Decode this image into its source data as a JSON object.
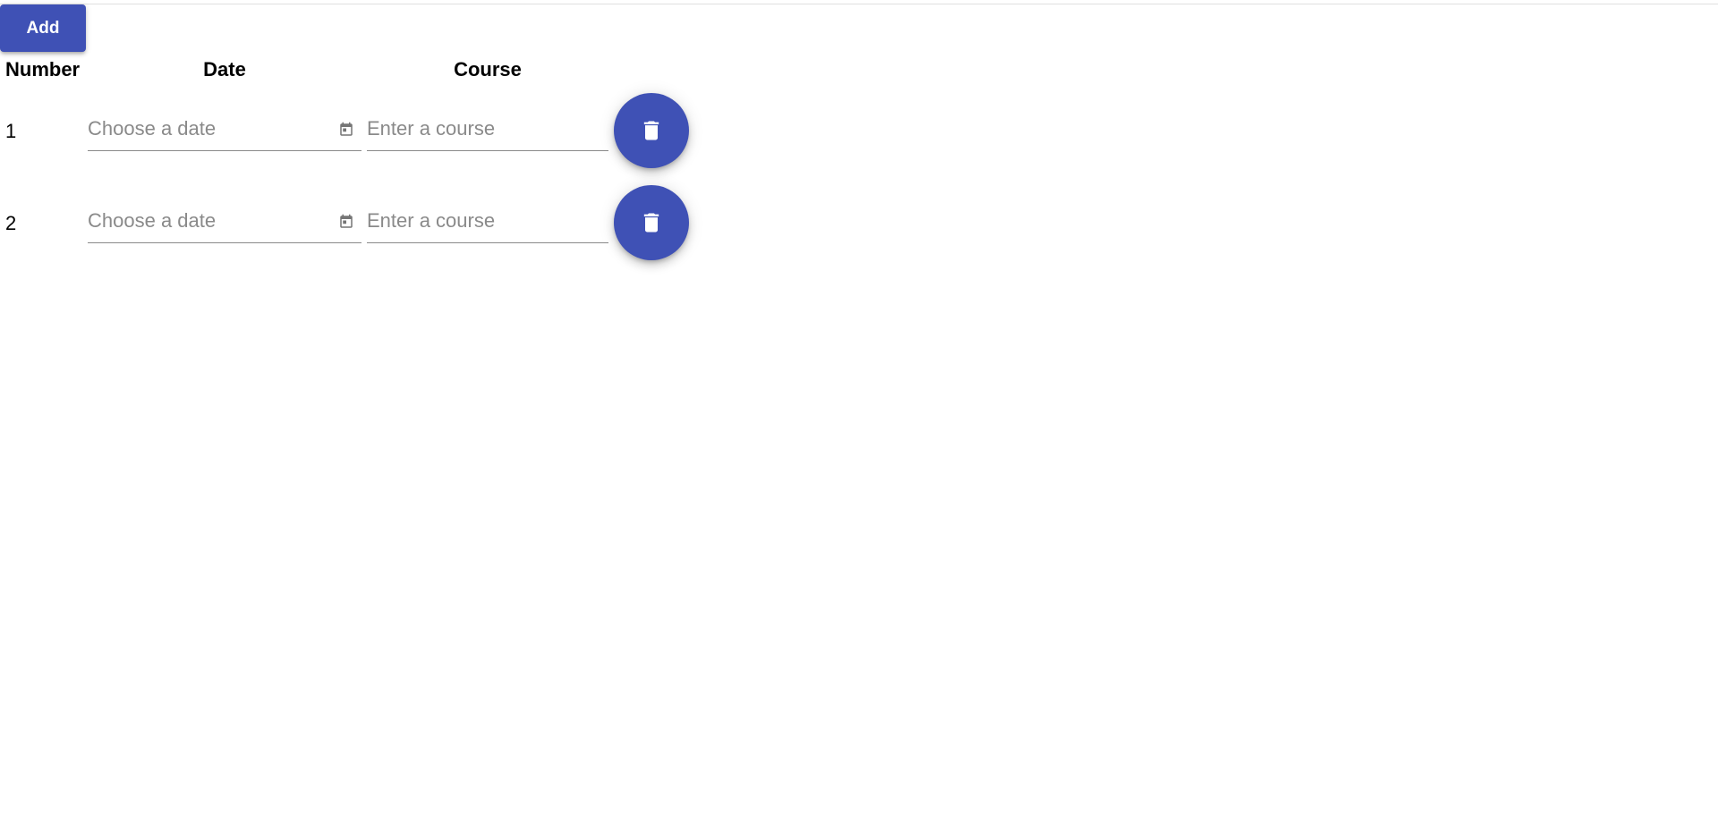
{
  "toolbar": {
    "add_label": "Add"
  },
  "table": {
    "headers": {
      "number": "Number",
      "date": "Date",
      "course": "Course"
    },
    "rows": [
      {
        "number": "1",
        "date": {
          "value": "",
          "placeholder": "Choose a date"
        },
        "course": {
          "value": "",
          "placeholder": "Enter a course"
        }
      },
      {
        "number": "2",
        "date": {
          "value": "",
          "placeholder": "Choose a date"
        },
        "course": {
          "value": "",
          "placeholder": "Enter a course"
        }
      }
    ]
  },
  "icons": {
    "calendar": "calendar-icon",
    "delete": "trash-icon"
  },
  "colors": {
    "primary": "#3f51b5",
    "icon_gray": "#757575"
  }
}
